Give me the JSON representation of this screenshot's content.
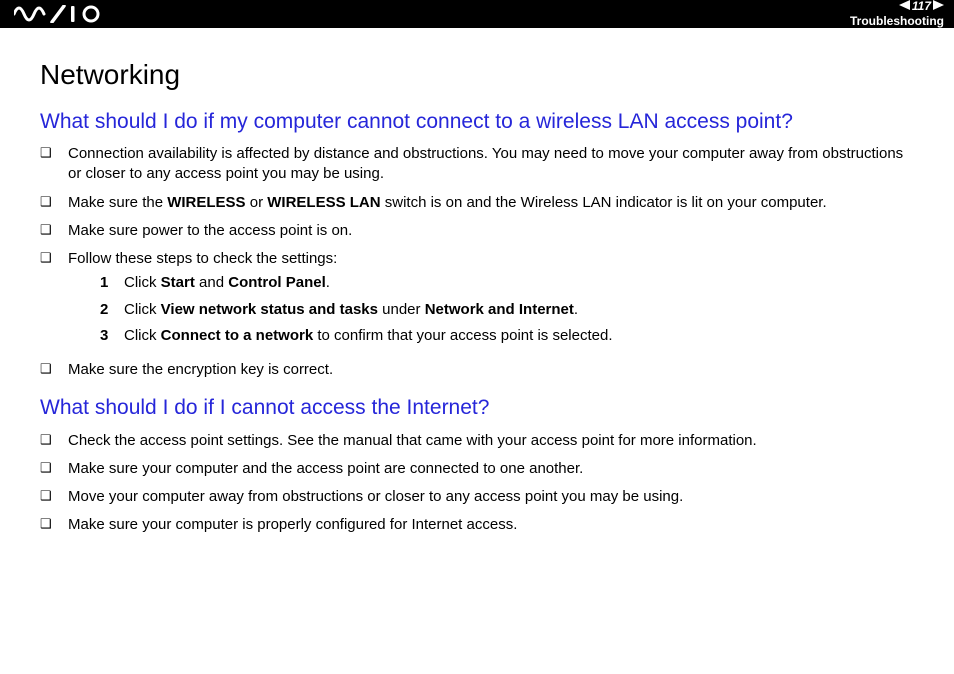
{
  "header": {
    "page_number": "117",
    "section": "Troubleshooting"
  },
  "page": {
    "title": "Networking",
    "q1": {
      "heading": "What should I do if my computer cannot connect to a wireless LAN access point?",
      "b1": "Connection availability is affected by distance and obstructions. You may need to move your computer away from obstructions or closer to any access point you may be using.",
      "b2_pre": "Make sure the ",
      "b2_bold1": "WIRELESS",
      "b2_mid": " or ",
      "b2_bold2": "WIRELESS LAN",
      "b2_post": " switch is on and the Wireless LAN indicator is lit on your computer.",
      "b3": "Make sure power to the access point is on.",
      "b4": "Follow these steps to check the settings:",
      "steps": {
        "s1_pre": "Click ",
        "s1_b1": "Start",
        "s1_mid": " and ",
        "s1_b2": "Control Panel",
        "s1_post": ".",
        "s2_pre": "Click ",
        "s2_b1": "View network status and tasks",
        "s2_mid": " under ",
        "s2_b2": "Network and Internet",
        "s2_post": ".",
        "s3_pre": "Click ",
        "s3_b1": "Connect to a network",
        "s3_post": " to confirm that your access point is selected."
      },
      "b5": "Make sure the encryption key is correct."
    },
    "q2": {
      "heading": "What should I do if I cannot access the Internet?",
      "b1": "Check the access point settings. See the manual that came with your access point for more information.",
      "b2": "Make sure your computer and the access point are connected to one another.",
      "b3": "Move your computer away from obstructions or closer to any access point you may be using.",
      "b4": "Make sure your computer is properly configured for Internet access."
    }
  }
}
